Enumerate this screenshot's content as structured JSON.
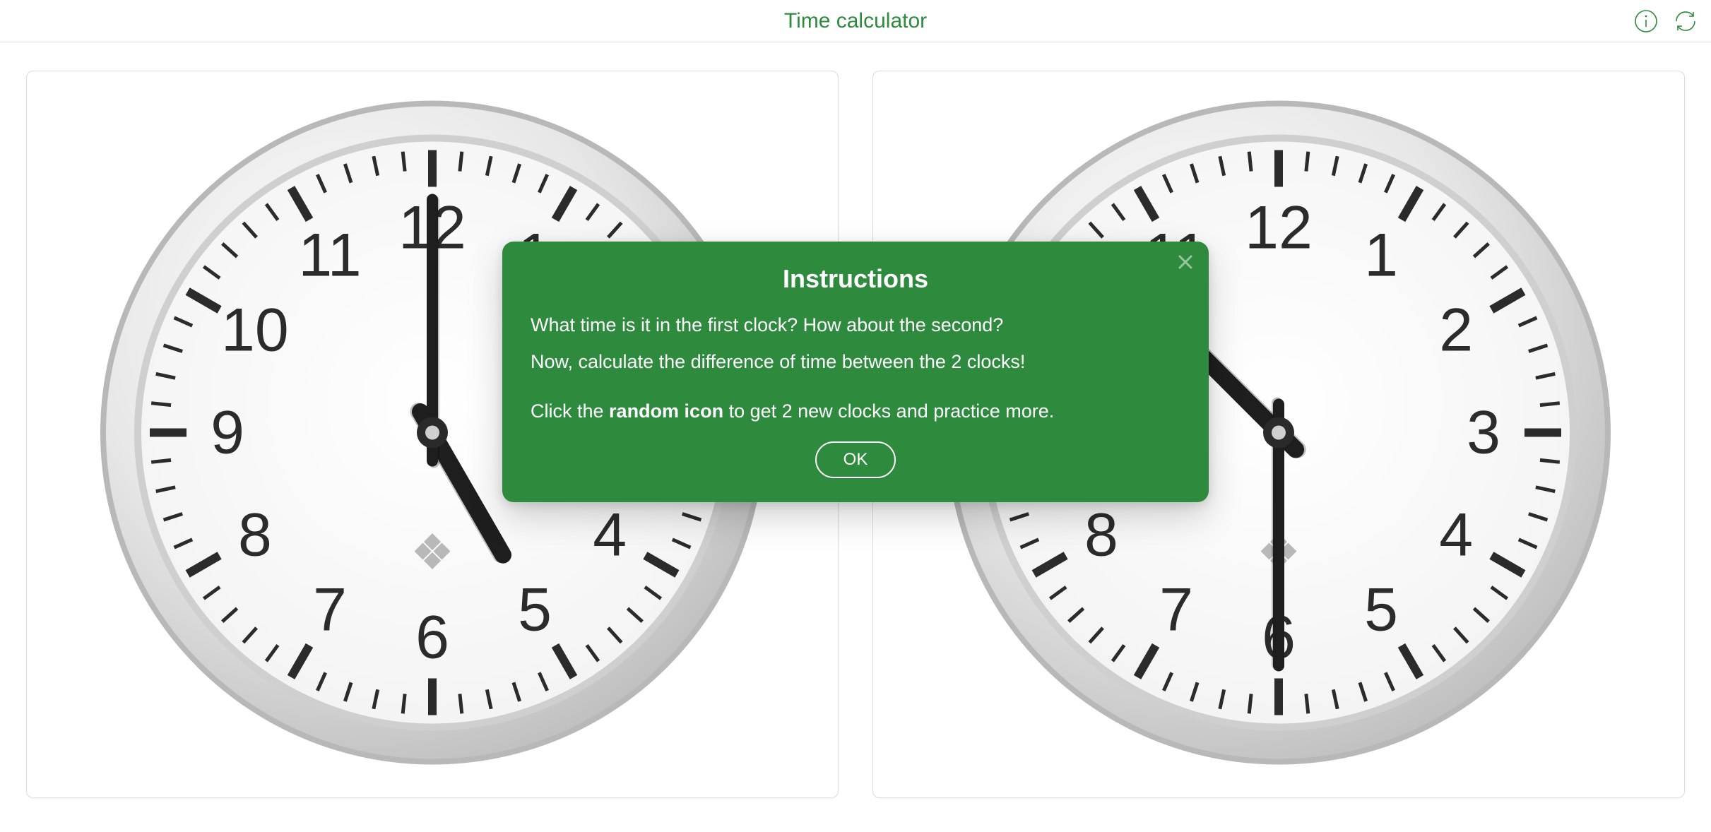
{
  "header": {
    "title": "Time calculator"
  },
  "clock1": {
    "hour": 5,
    "minute": 0
  },
  "clock2": {
    "hour": 10,
    "minute": 30
  },
  "modal": {
    "title": "Instructions",
    "line1": "What time is it in the first clock? How about the second?",
    "line2": "Now, calculate the difference of time between the 2 clocks!",
    "line3_pre": "Click the ",
    "line3_bold": "random icon",
    "line3_post": " to get 2 new clocks and practice more.",
    "ok": "OK"
  },
  "numerals": [
    "12",
    "1",
    "2",
    "3",
    "4",
    "5",
    "6",
    "7",
    "8",
    "9",
    "10",
    "11"
  ]
}
